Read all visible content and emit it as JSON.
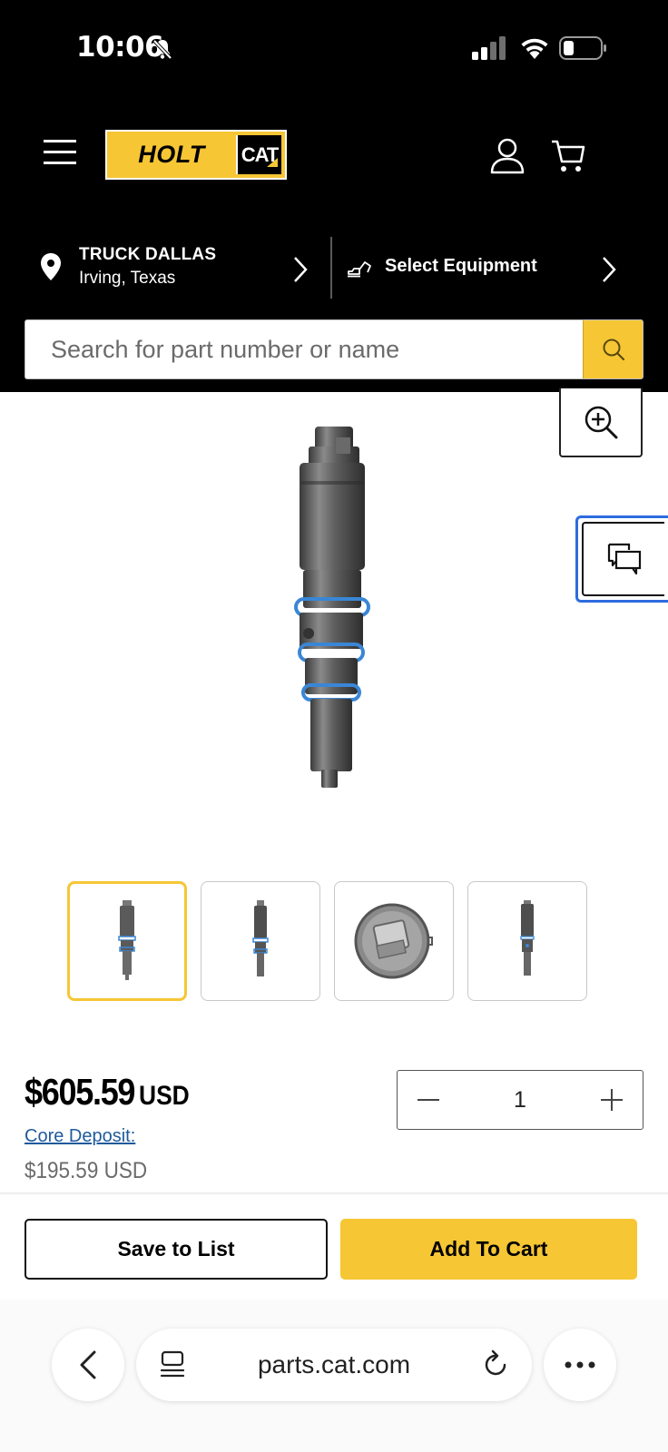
{
  "status_bar": {
    "time": "10:06",
    "icons": [
      "bell-muted-icon",
      "cellular-signal-icon",
      "wifi-icon",
      "battery-icon"
    ]
  },
  "header": {
    "logo": {
      "primary": "HOLT",
      "secondary": "CAT"
    },
    "icons": [
      "hamburger-menu-icon",
      "account-icon",
      "cart-icon"
    ],
    "brand_color": "#f6c634"
  },
  "store": {
    "name": "TRUCK DALLAS",
    "location": "Irving, Texas"
  },
  "equipment": {
    "label": "Select Equipment"
  },
  "search": {
    "placeholder": "Search for part number or name",
    "value": ""
  },
  "gallery": {
    "thumbnail_count": 4,
    "selected_index": 0,
    "accent_ring_color": "#3a86d6"
  },
  "product": {
    "price": "$605.59",
    "currency": "USD",
    "core_deposit_label": "Core Deposit:",
    "core_deposit_price": "$195.59 USD",
    "quantity": "1"
  },
  "actions": {
    "save_label": "Save to List",
    "add_label": "Add To Cart"
  },
  "browser": {
    "url": "parts.cat.com"
  }
}
